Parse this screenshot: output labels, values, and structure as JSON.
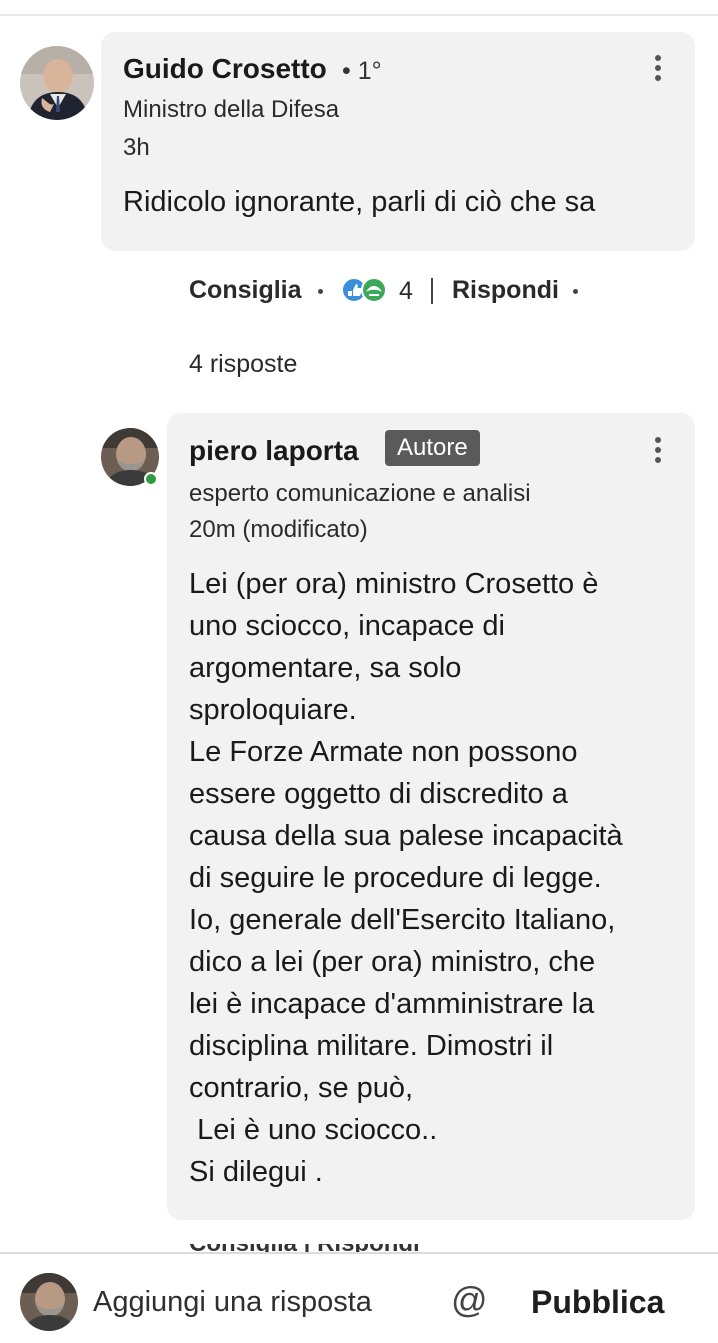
{
  "comment": {
    "author": "Guido Crosetto",
    "degree": "• 1°",
    "headline": "Ministro della Difesa",
    "time": "3h",
    "text": "Ridicolo ignorante, parli di ciò che sa"
  },
  "actions": {
    "like": "Consiglia",
    "reaction_count": "4",
    "reply": "Rispondi"
  },
  "replies_count": "4 risposte",
  "reply": {
    "author": "piero laporta",
    "badge": "Autore",
    "headline": "esperto comunicazione e analisi",
    "time": "20m (modificato)",
    "text": "Lei (per ora) ministro Crosetto è\nuno sciocco, incapace di\nargomentare, sa solo\nsproloquiare.\nLe Forze Armate non possono\nessere oggetto di discredito a\ncausa della sua palese incapacità\ndi seguire le procedure di legge.\nIo, generale dell'Esercito Italiano,\ndico a lei (per ora) ministro, che\nlei è incapace d'amministrare la\ndisciplina militare. Dimostri il\ncontrario, se può,\n Lei è uno sciocco..\nSi dilegui ."
  },
  "reply_actions_cut": "Consiglia | Rispondi",
  "composer": {
    "placeholder": "Aggiungi una risposta",
    "at_symbol": "@",
    "publish": "Pubblica"
  },
  "colors": {
    "bubble": "#f2f2f2",
    "badge": "#5a5a5a",
    "online": "#2e9d40"
  },
  "icons": [
    "kebab-menu-icon",
    "reaction-icons",
    "at-icon"
  ]
}
